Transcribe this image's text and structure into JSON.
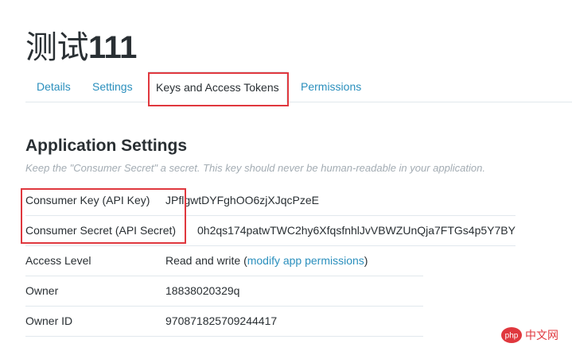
{
  "app": {
    "title_cn": "测试",
    "title_num": "111"
  },
  "tabs": [
    {
      "label": "Details"
    },
    {
      "label": "Settings"
    },
    {
      "label": "Keys and Access Tokens"
    },
    {
      "label": "Permissions"
    }
  ],
  "settings": {
    "title": "Application Settings",
    "note": "Keep the \"Consumer Secret\" a secret. This key should never be human-readable in your application.",
    "rows": [
      {
        "label": "Consumer Key (API Key)",
        "value": "JPflgwtDYFghOO6zjXJqcPzeE"
      },
      {
        "label": "Consumer Secret (API Secret)",
        "value": "0h2qs174patwTWC2hy6XfqsfnhlJvVBWZUnQja7FTGs4p5Y7BY"
      },
      {
        "label": "Access Level",
        "value": "Read and write",
        "link_open": "(",
        "link": "modify app permissions",
        "link_close": ")"
      },
      {
        "label": "Owner",
        "value": "18838020329q"
      },
      {
        "label": "Owner ID",
        "value": "970871825709244417"
      }
    ]
  },
  "watermark": {
    "text": "php 中文网",
    "color": "#e0383e"
  },
  "colors": {
    "link": "#2a8fbd",
    "highlight": "#e0383e",
    "text": "#292f33",
    "muted": "#a3acb3"
  }
}
